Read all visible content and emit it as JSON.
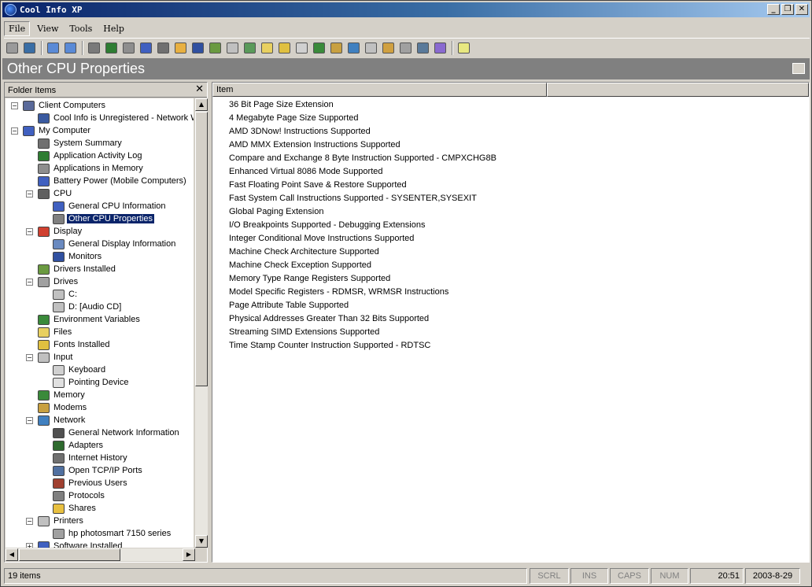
{
  "window": {
    "title": "Cool Info XP",
    "controls": {
      "minimize": "_",
      "restore": "❐",
      "close": "✕"
    }
  },
  "menu": [
    {
      "label": "File",
      "active": true
    },
    {
      "label": "View",
      "active": false
    },
    {
      "label": "Tools",
      "active": false
    },
    {
      "label": "Help",
      "active": false
    }
  ],
  "toolbar": {
    "icons": [
      "printer-icon",
      "client-connect-icon",
      "sep",
      "refresh-icon",
      "refresh-network-icon",
      "sep",
      "system-summary-icon",
      "activity-log-icon",
      "applications-icon",
      "battery-icon",
      "cpu-icon",
      "display-icon",
      "monitor-icon",
      "drivers-icon",
      "drives-icon",
      "environment-icon",
      "files-icon",
      "fonts-icon",
      "input-icon",
      "memory-icon",
      "modems-icon",
      "network-icon",
      "printers-icon",
      "software-icon",
      "sound-icon",
      "services-icon",
      "startup-icon",
      "sep",
      "help-icon"
    ],
    "colors": [
      "#9a9a9a",
      "#3a6ea5",
      "",
      "#5a8ad6",
      "#5a8ad6",
      "",
      "#7a7a7a",
      "#2e7d32",
      "#8e8e8e",
      "#4060c0",
      "#707070",
      "#e8b040",
      "#3050a0",
      "#6a9a40",
      "#c0c0c0",
      "#5a9a5a",
      "#e8d060",
      "#e0c040",
      "#d0d0d0",
      "#3a8a3a",
      "#c8a040",
      "#4080c0",
      "#c0c0c0",
      "#d0a040",
      "#a0a0a0",
      "#5a7a9a",
      "#8a6ad0",
      "",
      "#e8e880"
    ]
  },
  "page": {
    "title": "Other CPU Properties"
  },
  "folder_pane": {
    "header": "Folder Items",
    "close": "✕",
    "tree": [
      {
        "label": "Client Computers",
        "level": 0,
        "expander": "−",
        "icon": "client-computers-icon",
        "color": "#5a6a9a"
      },
      {
        "label": "Cool Info is Unregistered - Network W",
        "level": 1,
        "icon": "network-computer-icon",
        "color": "#3a5aa0"
      },
      {
        "label": "My Computer",
        "level": 0,
        "expander": "−",
        "icon": "my-computer-icon",
        "color": "#4060c0"
      },
      {
        "label": "System Summary",
        "level": 1,
        "icon": "system-summary-icon",
        "color": "#707070"
      },
      {
        "label": "Application Activity Log",
        "level": 1,
        "icon": "activity-log-icon",
        "color": "#2e7d32"
      },
      {
        "label": "Applications in Memory",
        "level": 1,
        "icon": "applications-icon",
        "color": "#8e8e8e"
      },
      {
        "label": "Battery Power (Mobile Computers)",
        "level": 1,
        "icon": "battery-icon",
        "color": "#4060c0"
      },
      {
        "label": "CPU",
        "level": 1,
        "expander": "−",
        "icon": "cpu-icon",
        "color": "#606060"
      },
      {
        "label": "General CPU Information",
        "level": 2,
        "icon": "cpu-info-icon",
        "color": "#4060c0"
      },
      {
        "label": "Other CPU Properties",
        "level": 2,
        "icon": "cpu-properties-icon",
        "color": "#808080",
        "selected": true
      },
      {
        "label": "Display",
        "level": 1,
        "expander": "−",
        "icon": "display-icon",
        "color": "#d04030"
      },
      {
        "label": "General Display Information",
        "level": 2,
        "icon": "display-info-icon",
        "color": "#6a8ac0"
      },
      {
        "label": "Monitors",
        "level": 2,
        "icon": "monitor-icon",
        "color": "#3050a0"
      },
      {
        "label": "Drivers Installed",
        "level": 1,
        "icon": "drivers-icon",
        "color": "#6a9a40"
      },
      {
        "label": "Drives",
        "level": 1,
        "expander": "−",
        "icon": "drives-icon",
        "color": "#a0a0a0"
      },
      {
        "label": "C:",
        "level": 2,
        "icon": "hard-drive-icon",
        "color": "#c0c0c0"
      },
      {
        "label": "D: [Audio CD]",
        "level": 2,
        "icon": "cd-drive-icon",
        "color": "#c0c0c0"
      },
      {
        "label": "Environment Variables",
        "level": 1,
        "icon": "environment-icon",
        "color": "#3a8a3a"
      },
      {
        "label": "Files",
        "level": 1,
        "icon": "files-icon",
        "color": "#e8d060"
      },
      {
        "label": "Fonts Installed",
        "level": 1,
        "icon": "fonts-icon",
        "color": "#e0c040"
      },
      {
        "label": "Input",
        "level": 1,
        "expander": "−",
        "icon": "input-icon",
        "color": "#c0c0c0"
      },
      {
        "label": "Keyboard",
        "level": 2,
        "icon": "keyboard-icon",
        "color": "#d0d0d0"
      },
      {
        "label": "Pointing Device",
        "level": 2,
        "icon": "mouse-icon",
        "color": "#e0e0e0"
      },
      {
        "label": "Memory",
        "level": 1,
        "icon": "memory-icon",
        "color": "#3a8a3a"
      },
      {
        "label": "Modems",
        "level": 1,
        "icon": "modems-icon",
        "color": "#c8a040"
      },
      {
        "label": "Network",
        "level": 1,
        "expander": "−",
        "icon": "network-icon",
        "color": "#4080c0"
      },
      {
        "label": "General Network Information",
        "level": 2,
        "icon": "network-info-icon",
        "color": "#505050"
      },
      {
        "label": "Adapters",
        "level": 2,
        "icon": "adapters-icon",
        "color": "#2e6a2e"
      },
      {
        "label": "Internet History",
        "level": 2,
        "icon": "internet-history-icon",
        "color": "#707070"
      },
      {
        "label": "Open TCP/IP Ports",
        "level": 2,
        "icon": "tcp-ports-icon",
        "color": "#5070a0"
      },
      {
        "label": "Previous Users",
        "level": 2,
        "icon": "users-icon",
        "color": "#a04030"
      },
      {
        "label": "Protocols",
        "level": 2,
        "icon": "protocols-icon",
        "color": "#808080"
      },
      {
        "label": "Shares",
        "level": 2,
        "icon": "shares-icon",
        "color": "#e8c040"
      },
      {
        "label": "Printers",
        "level": 1,
        "expander": "−",
        "icon": "printers-icon",
        "color": "#c0c0c0"
      },
      {
        "label": "hp photosmart 7150 series",
        "level": 2,
        "icon": "printer-icon",
        "color": "#a0a0a0"
      },
      {
        "label": "Software Installed",
        "level": 1,
        "expander": "+",
        "icon": "software-icon",
        "color": "#4060c0"
      }
    ]
  },
  "list": {
    "columns": [
      "Item",
      ""
    ],
    "items": [
      "36 Bit Page Size Extension",
      "4 Megabyte Page Size Supported",
      "AMD 3DNow! Instructions Supported",
      "AMD MMX Extension Instructions Supported",
      "Compare and Exchange 8 Byte Instruction Supported - CMPXCHG8B",
      "Enhanced Virtual 8086 Mode Supported",
      "Fast Floating Point Save & Restore Supported",
      "Fast System Call Instructions Supported - SYSENTER,SYSEXIT",
      "Global Paging Extension",
      "I/O Breakpoints Supported - Debugging Extensions",
      "Integer Conditional Move Instructions Supported",
      "Machine Check Architecture Supported",
      "Machine Check Exception Supported",
      "Memory Type Range Registers Supported",
      "Model Specific Registers - RDMSR, WRMSR Instructions",
      "Page Attribute Table Supported",
      "Physical Addresses Greater Than 32 Bits Supported",
      "Streaming SIMD Extensions Supported",
      "Time Stamp Counter Instruction Supported - RDTSC"
    ]
  },
  "statusbar": {
    "count": "19 items",
    "scrl": "SCRL",
    "ins": "INS",
    "caps": "CAPS",
    "num": "NUM",
    "time": "20:51",
    "date": "2003-8-29"
  },
  "scroll": {
    "up": "▲",
    "down": "▼",
    "left": "◀",
    "right": "▶"
  }
}
